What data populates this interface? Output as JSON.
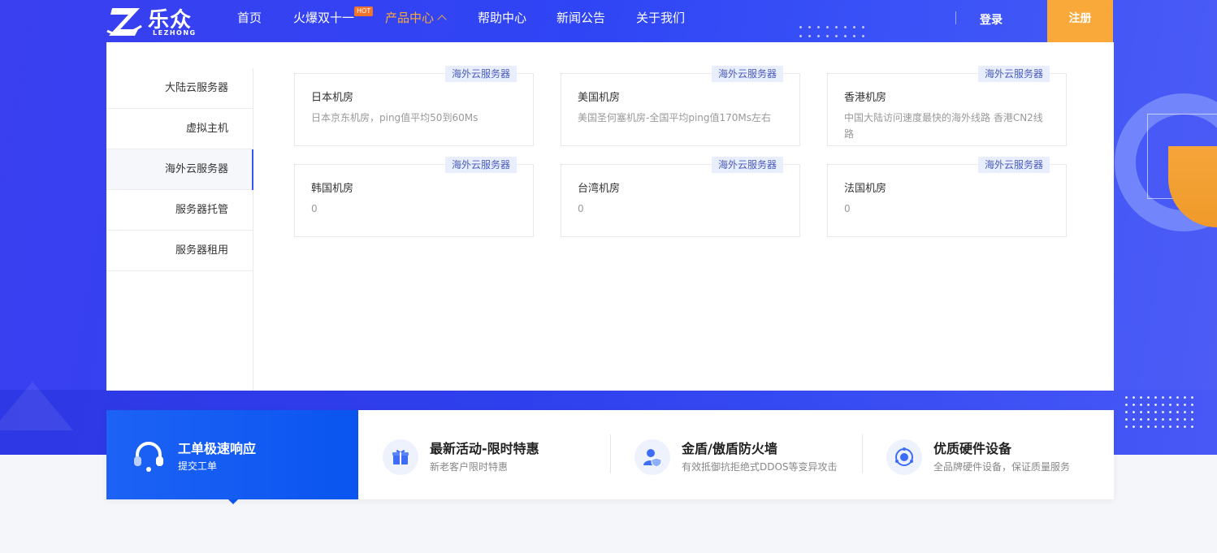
{
  "logo": {
    "cn": "乐众",
    "en": "LEZHONG"
  },
  "nav": [
    {
      "label": "首页"
    },
    {
      "label": "火爆双十一",
      "badge": "HOT"
    },
    {
      "label": "产品中心",
      "active": true
    },
    {
      "label": "帮助中心"
    },
    {
      "label": "新闻公告"
    },
    {
      "label": "关于我们"
    }
  ],
  "auth": {
    "login": "登录",
    "register": "注册"
  },
  "sidebar": {
    "items": [
      {
        "label": "大陆云服务器"
      },
      {
        "label": "虚拟主机"
      },
      {
        "label": "海外云服务器",
        "active": true
      },
      {
        "label": "服务器托管"
      },
      {
        "label": "服务器租用"
      }
    ]
  },
  "products": [
    {
      "tag": "海外云服务器",
      "title": "日本机房",
      "desc": "日本京东机房，ping值平均50到60Ms"
    },
    {
      "tag": "海外云服务器",
      "title": "美国机房",
      "desc": "美国圣何塞机房-全国平均ping值170Ms左右"
    },
    {
      "tag": "海外云服务器",
      "title": "香港机房",
      "desc": "中国大陆访问速度最快的海外线路 香港CN2线路"
    },
    {
      "tag": "海外云服务器",
      "title": "韩国机房",
      "desc": "0"
    },
    {
      "tag": "海外云服务器",
      "title": "台湾机房",
      "desc": "0"
    },
    {
      "tag": "海外云服务器",
      "title": "法国机房",
      "desc": "0"
    }
  ],
  "features": [
    {
      "title": "工单极速响应",
      "subtitle": "提交工单",
      "icon": "headset-icon"
    },
    {
      "title": "最新活动-限时特惠",
      "subtitle": "新老客户限时特惠",
      "icon": "gift-icon"
    },
    {
      "title": "金盾/傲盾防火墙",
      "subtitle": "有效抵御抗拒绝式DDOS等变异攻击",
      "icon": "user-shield-icon"
    },
    {
      "title": "优质硬件设备",
      "subtitle": "全品牌硬件设备，保证质量服务",
      "icon": "hardware-icon"
    }
  ],
  "colors": {
    "brand": "#2f45f5",
    "accent": "#f9a93a",
    "strip_active": "#1d62f5"
  }
}
